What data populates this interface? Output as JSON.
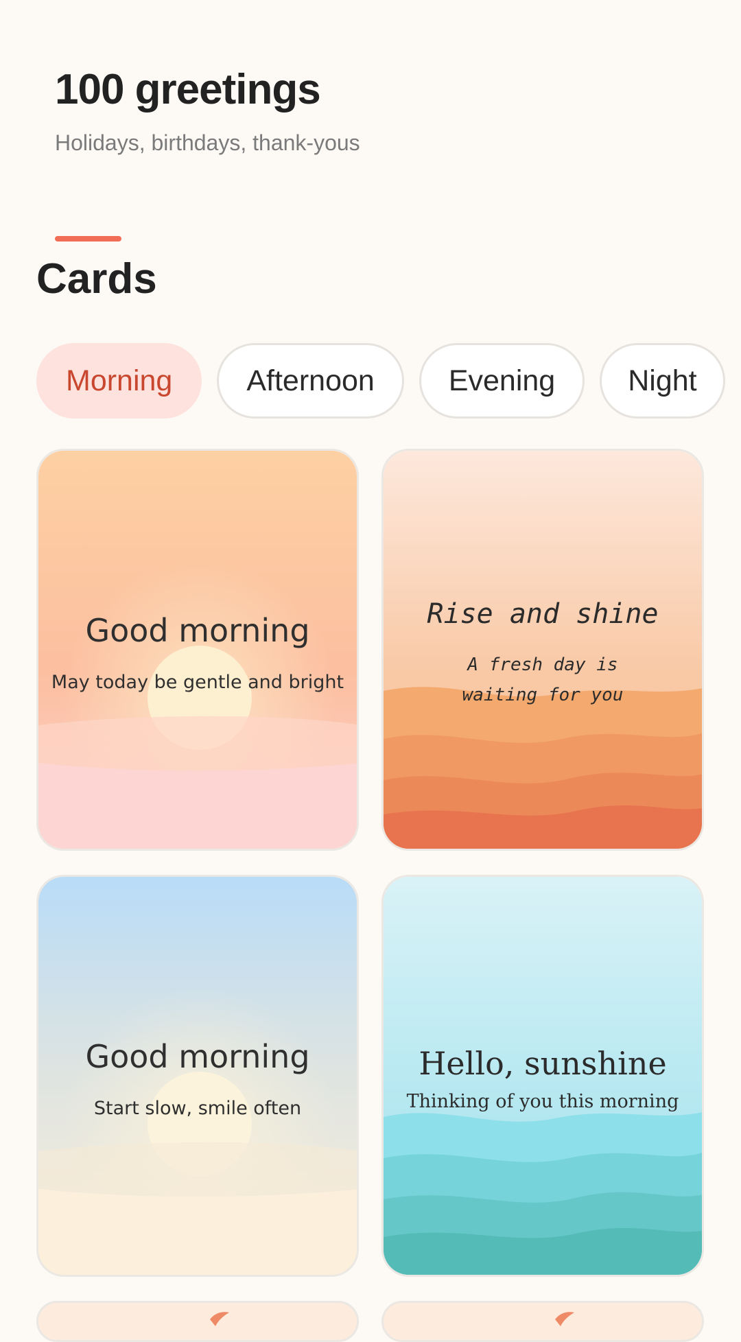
{
  "header": {
    "title": "100 greetings",
    "subtitle": "Holidays, birthdays, thank-yous"
  },
  "section": {
    "title": "Cards"
  },
  "filters": [
    {
      "label": "Morning",
      "active": true
    },
    {
      "label": "Afternoon",
      "active": false
    },
    {
      "label": "Evening",
      "active": false
    },
    {
      "label": "Night",
      "active": false
    }
  ],
  "cards": [
    {
      "title": "Good morning",
      "subtitle": "May today be gentle and bright"
    },
    {
      "title": "Rise and shine",
      "subtitle": "A fresh day is waiting for you"
    },
    {
      "title": "Good morning",
      "subtitle": "Start slow, smile often"
    },
    {
      "title": "Hello, sunshine",
      "subtitle": "Thinking of you this morning"
    }
  ],
  "colors": {
    "accent": "#f26d56",
    "chip_active_bg": "#fde2dd",
    "chip_active_text": "#c9472f",
    "background": "#fdfaf6"
  }
}
